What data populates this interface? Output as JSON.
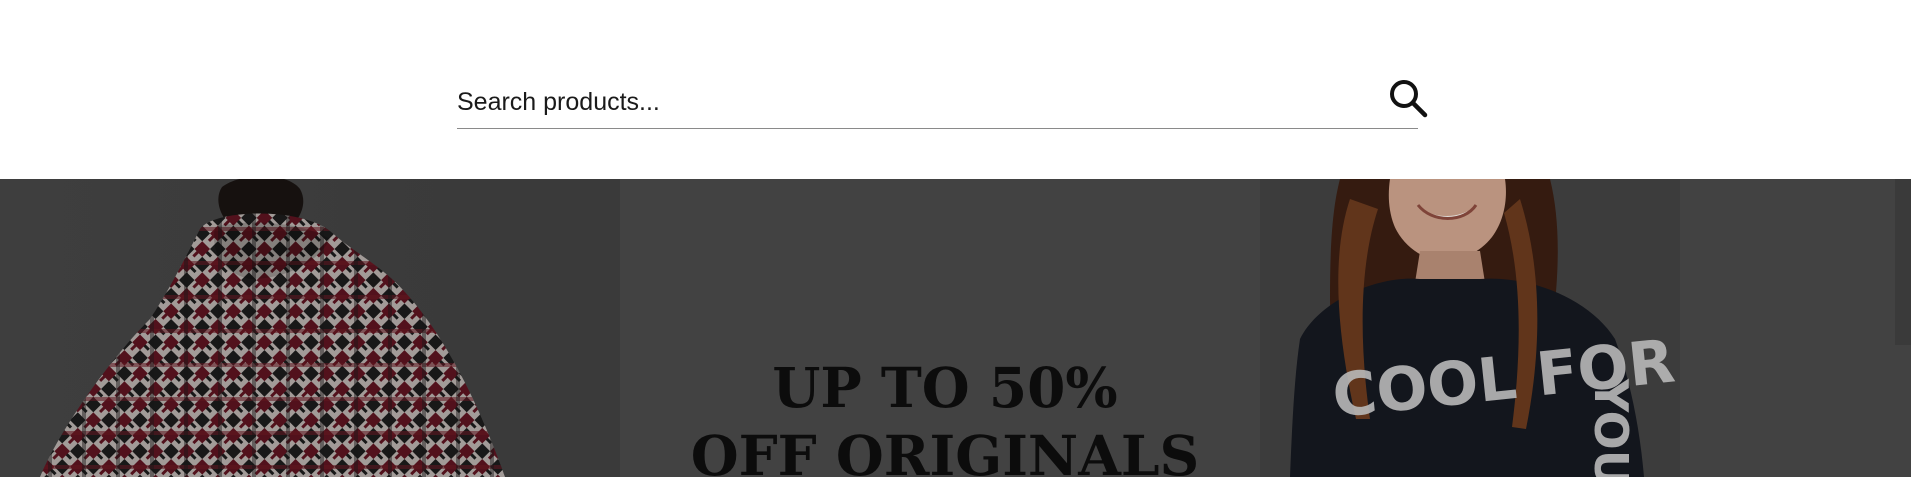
{
  "search": {
    "placeholder": "Search products...",
    "icon": "search-icon"
  },
  "hero": {
    "headline_line1": "UP TO 50%",
    "headline_line2": "OFF ORIGINALS",
    "background_color": "#424242",
    "sweater_print_text": "COOL FOR YOU"
  }
}
